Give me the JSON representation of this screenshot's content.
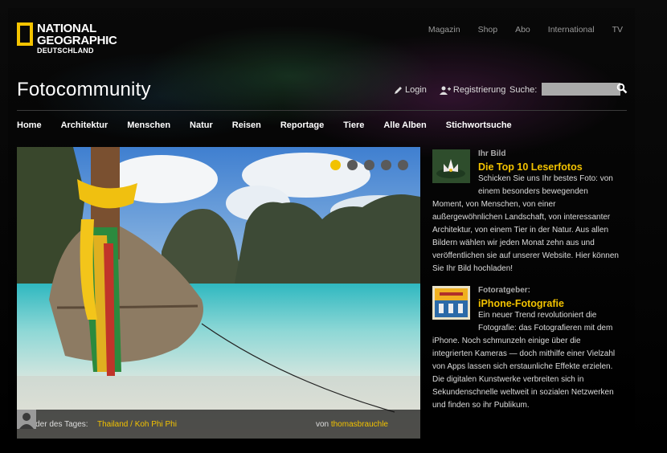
{
  "brand": {
    "line1": "NATIONAL",
    "line2": "GEOGRAPHIC",
    "line3": "DEUTSCHLAND",
    "accent": "#f5c400"
  },
  "topnav": [
    "Magazin",
    "Shop",
    "Abo",
    "International",
    "TV"
  ],
  "title": "Fotocommunity",
  "account": {
    "login": "Login",
    "register": "Registrierung"
  },
  "search": {
    "label": "Suche:",
    "value": ""
  },
  "mainnav": [
    "Home",
    "Architektur",
    "Menschen",
    "Natur",
    "Reisen",
    "Reportage",
    "Tiere",
    "Alle Alben",
    "Stichwortsuche"
  ],
  "hero": {
    "dots_total": 5,
    "active_dot": 1,
    "caption_label": "Bilder des Tages:",
    "caption_link": "Thailand / Koh Phi Phi",
    "by_prefix": "von",
    "author": "thomasbrauchle"
  },
  "sidebar": [
    {
      "kicker": "Ihr Bild",
      "heading": "Die Top 10 Leserfotos",
      "lines": [
        "Schicken Sie uns Ihr bestes Foto: von",
        "einem besonders bewegenden",
        "Moment, von Menschen, von einer",
        "außergewöhnlichen Landschaft, von interessanter",
        "Architektur, von einem Tier in der Natur. Aus allen",
        "Bildern wählen wir jeden Monat zehn aus und",
        "veröffentlichen sie auf unserer Website. Hier können",
        "Sie Ihr Bild hochladen!"
      ]
    },
    {
      "kicker": "Fotoratgeber:",
      "heading": "iPhone-Fotografie",
      "lines": [
        "Ein neuer Trend revolutioniert die",
        "Fotografie: das Fotografieren mit dem",
        "iPhone. Noch schmunzeln einige über die",
        "integrierten Kameras — doch mithilfe einer Vielzahl",
        "von Apps lassen sich erstaunliche Effekte erzielen.",
        "Die digitalen Kunstwerke verbreiten sich in",
        "Sekundenschnelle weltweit in sozialen Netzwerken",
        "und finden so ihr Publikum."
      ]
    }
  ]
}
